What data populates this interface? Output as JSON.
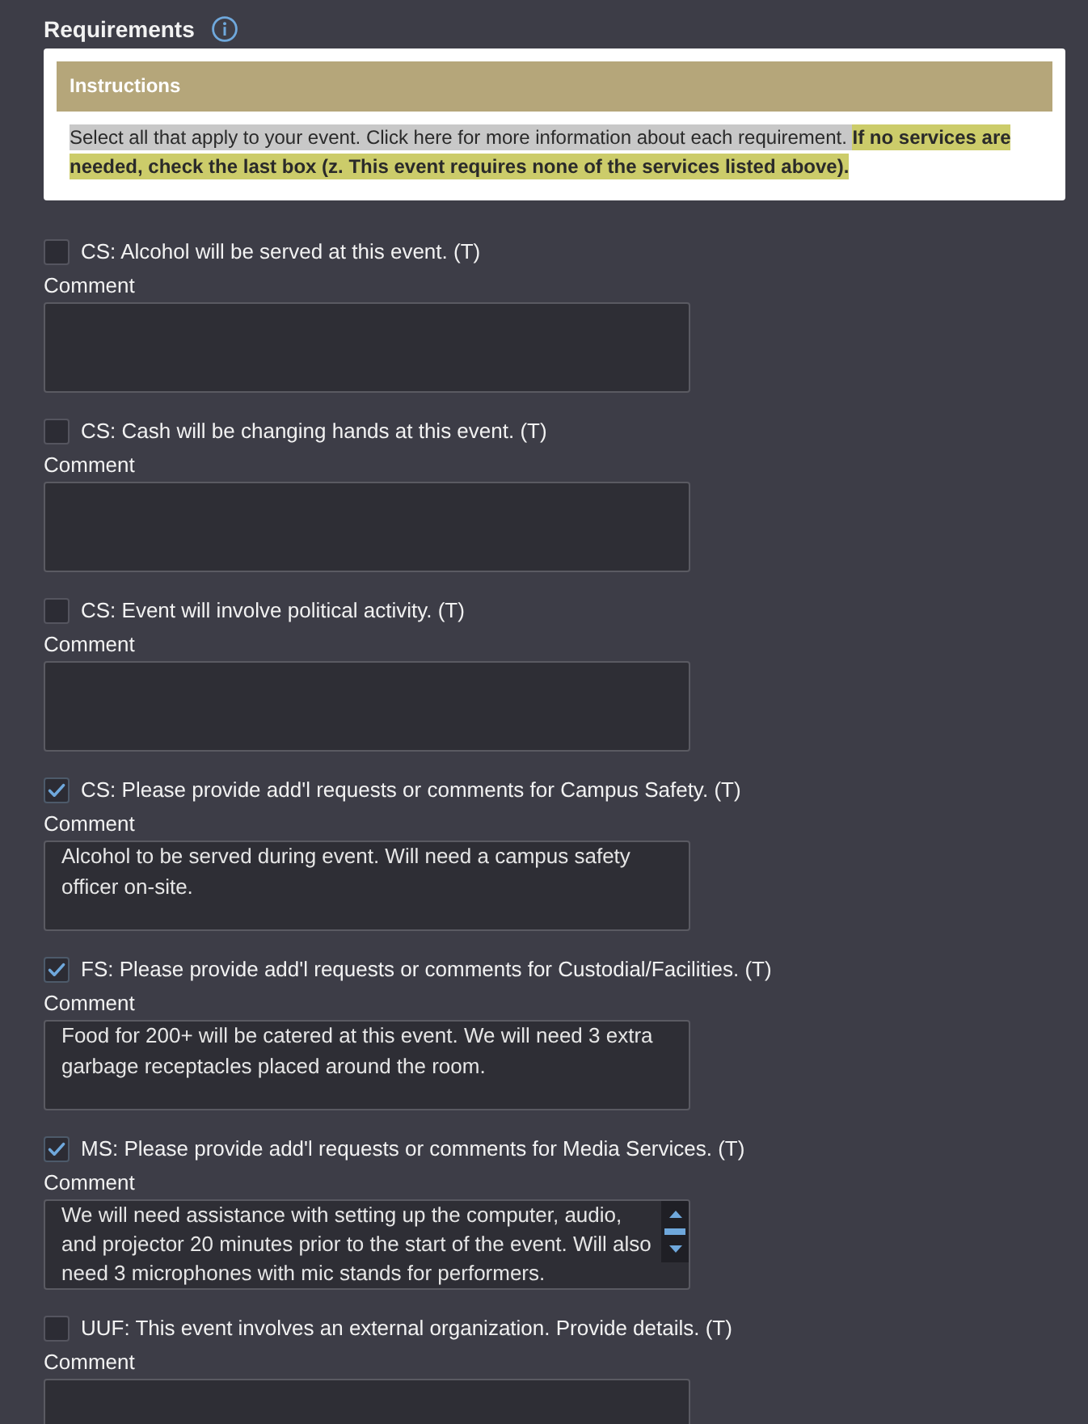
{
  "section": {
    "title": "Requirements"
  },
  "instructions": {
    "title": "Instructions",
    "text": "Select all that apply to your event. Click here for more information about each requirement. **If no services are needed, check the last box (z. This event requires none of the services listed above).**"
  },
  "requirements": [
    {
      "label": "CS: Alcohol will be served at this event. (T)",
      "checked": false,
      "comment_label": "Comment",
      "scrollbar": false
    },
    {
      "label": "CS: Cash will be changing hands at this event. (T)",
      "checked": false,
      "comment_label": "Comment",
      "scrollbar": false
    },
    {
      "label": "CS: Event will involve political activity. (T)",
      "checked": false,
      "comment_label": "Comment",
      "scrollbar": false
    },
    {
      "label": "CS: Please provide add'l requests or comments for Campus Safety. (T)",
      "checked": true,
      "comment_label": "Comment",
      "comment": "Alcohol to be served during event. Will need a campus safety officer on-site.",
      "scrollbar": false
    },
    {
      "label": "FS: Please provide add'l requests or comments for Custodial/Facilities. (T)",
      "checked": true,
      "comment_label": "Comment",
      "comment": "Food for 200+ will be catered at this event. We will need 3 extra garbage receptacles placed around the room.",
      "scrollbar": false
    },
    {
      "label": "MS: Please provide add'l requests or comments for Media Services. (T)",
      "checked": true,
      "comment_label": "Comment",
      "comment": "We will need assistance with setting up the computer, audio, and projector 20 minutes prior to the start of the event. Will also need 3 microphones with mic stands for performers.",
      "scrollbar": true
    },
    {
      "label": "UUF: This event involves an external organization. Provide details. (T)",
      "checked": false,
      "comment_label": "Comment",
      "scrollbar": false
    }
  ]
}
